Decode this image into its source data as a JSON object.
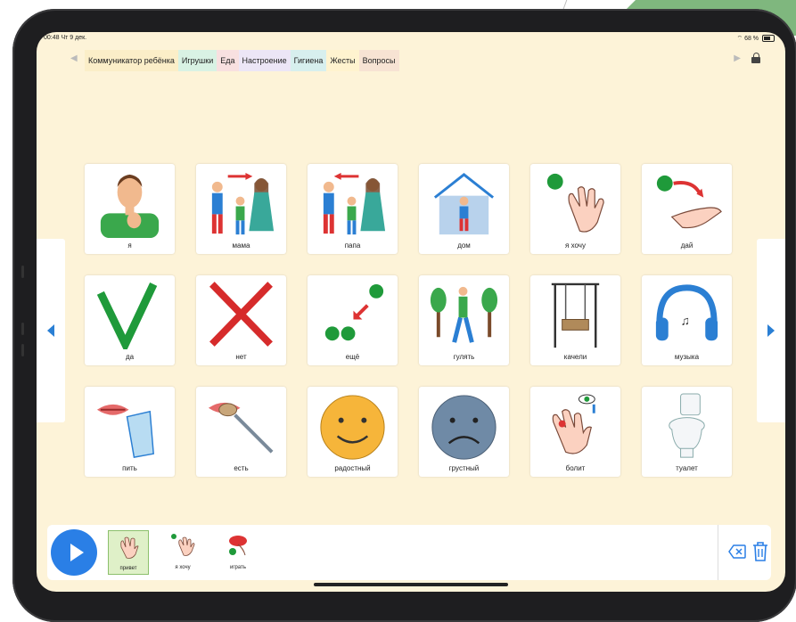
{
  "status": {
    "time": "00:48",
    "date": "Чт 9 дек.",
    "battery": "68 %"
  },
  "tabs": [
    {
      "label": "Коммуникатор ребёнка",
      "color": "#fbeec8"
    },
    {
      "label": "Игрушки",
      "color": "#d9f2e4"
    },
    {
      "label": "Еда",
      "color": "#f8e0e0"
    },
    {
      "label": "Настроение",
      "color": "#ece6f6"
    },
    {
      "label": "Гигиена",
      "color": "#d7efee"
    },
    {
      "label": "Жесты",
      "color": "#fff3cf"
    },
    {
      "label": "Вопросы",
      "color": "#f7e3d3"
    }
  ],
  "cards": [
    {
      "label": "я",
      "icon": "person-pointing-self-icon"
    },
    {
      "label": "мама",
      "icon": "family-mother-icon"
    },
    {
      "label": "папа",
      "icon": "family-father-icon"
    },
    {
      "label": "дом",
      "icon": "house-icon"
    },
    {
      "label": "я хочу",
      "icon": "hand-want-icon"
    },
    {
      "label": "дай",
      "icon": "hand-give-icon"
    },
    {
      "label": "да",
      "icon": "check-mark-icon"
    },
    {
      "label": "нет",
      "icon": "cross-mark-icon"
    },
    {
      "label": "ещё",
      "icon": "more-dots-icon"
    },
    {
      "label": "гулять",
      "icon": "walk-icon"
    },
    {
      "label": "качели",
      "icon": "swing-icon"
    },
    {
      "label": "музыка",
      "icon": "headphones-icon"
    },
    {
      "label": "пить",
      "icon": "drink-icon"
    },
    {
      "label": "есть",
      "icon": "eat-spoon-icon"
    },
    {
      "label": "радостный",
      "icon": "happy-face-icon"
    },
    {
      "label": "грустный",
      "icon": "sad-face-icon"
    },
    {
      "label": "болит",
      "icon": "hurt-hand-icon"
    },
    {
      "label": "туалет",
      "icon": "toilet-icon"
    }
  ],
  "sentence": [
    {
      "label": "привет",
      "icon": "wave-hand-icon",
      "active": true
    },
    {
      "label": "я хочу",
      "icon": "hand-want-icon",
      "active": false
    },
    {
      "label": "играть",
      "icon": "play-toy-icon",
      "active": false
    }
  ],
  "colors": {
    "accent": "#2a7fe6",
    "background": "#fdf3d8",
    "active_message": "#dff0c8"
  }
}
